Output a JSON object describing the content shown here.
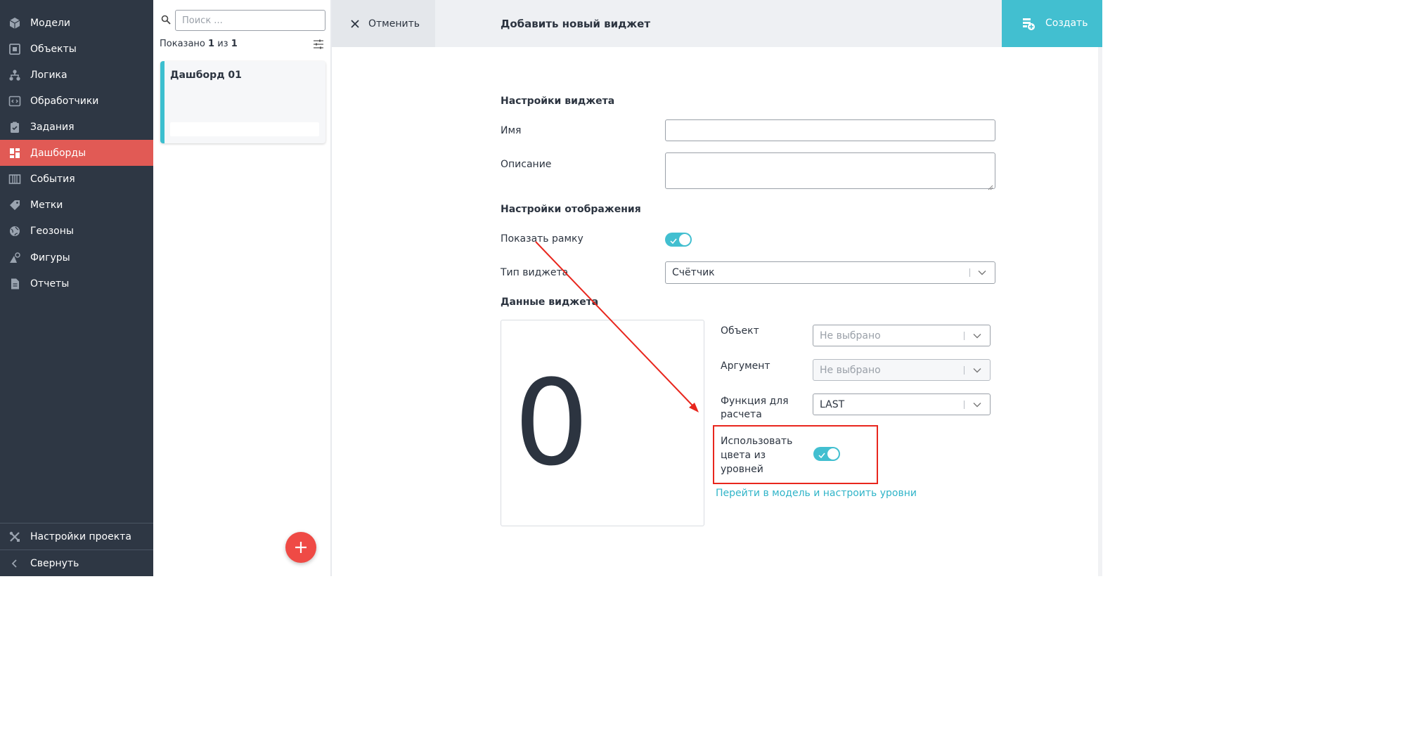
{
  "sidebar": {
    "items": [
      {
        "label": "Модели",
        "icon": "cube-icon"
      },
      {
        "label": "Объекты",
        "icon": "box-square-icon"
      },
      {
        "label": "Логика",
        "icon": "hierarchy-icon"
      },
      {
        "label": "Обработчики",
        "icon": "code-window-icon"
      },
      {
        "label": "Задания",
        "icon": "clipboard-check-icon"
      },
      {
        "label": "Дашборды",
        "icon": "dashboard-grid-icon",
        "active": true
      },
      {
        "label": "События",
        "icon": "columns-icon"
      },
      {
        "label": "Метки",
        "icon": "tag-icon"
      },
      {
        "label": "Геозоны",
        "icon": "globe-icon"
      },
      {
        "label": "Фигуры",
        "icon": "shapes-icon"
      },
      {
        "label": "Отчеты",
        "icon": "document-icon"
      }
    ],
    "footer": [
      {
        "label": "Настройки проекта",
        "icon": "tools-icon"
      },
      {
        "label": "Свернуть",
        "icon": "chevron-left-icon"
      }
    ]
  },
  "list": {
    "search_placeholder": "Поиск ...",
    "shown_prefix": "Показано",
    "shown_count": "1",
    "shown_middle": "из",
    "shown_total": "1",
    "cards": [
      {
        "title": "Дашборд 01"
      }
    ]
  },
  "topbar": {
    "cancel_label": "Отменить",
    "title": "Добавить новый виджет",
    "create_label": "Создать"
  },
  "form": {
    "widget_settings_title": "Настройки виджета",
    "name_label": "Имя",
    "name_value": "",
    "description_label": "Описание",
    "description_value": "",
    "display_settings_title": "Настройки отображения",
    "show_frame_label": "Показать рамку",
    "show_frame_on": true,
    "widget_type_label": "Тип виджета",
    "widget_type_value": "Счётчик",
    "widget_data_title": "Данные виджета",
    "preview_value": "0",
    "object_label": "Объект",
    "object_value": "Не выбрано",
    "argument_label": "Аргумент",
    "argument_value": "Не выбрано",
    "function_label_line1": "Функция для",
    "function_label_line2": "расчета",
    "function_value": "LAST",
    "use_colors_line1": "Использовать",
    "use_colors_line2": "цвета из",
    "use_colors_line3": "уровней",
    "use_colors_on": true,
    "levels_link": "Перейти в модель и настроить уровни"
  },
  "colors": {
    "sidebar_bg": "#2e3744",
    "active_item": "#e15a55",
    "accent": "#42bfd0",
    "fab": "#ef4a45",
    "annotation": "#e8261d"
  }
}
